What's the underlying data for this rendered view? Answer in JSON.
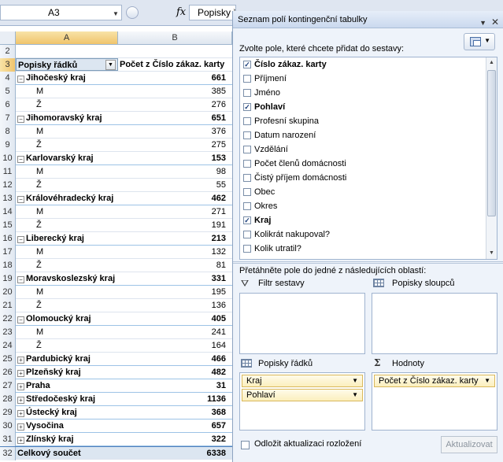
{
  "formula_bar": {
    "name_box": "A3",
    "fx": "fx",
    "formula": "Popisky řádků"
  },
  "grid": {
    "col_headers": [
      "A",
      "B"
    ],
    "header": {
      "row": "3",
      "label_a": "Popisky řádků",
      "label_b": "Počet z Číslo zákaz. karty"
    },
    "rows": [
      {
        "num": "4",
        "label": "Jihočeský kraj",
        "value": "661",
        "kind": "region",
        "exp": "⊟"
      },
      {
        "num": "5",
        "label": "M",
        "value": "385",
        "kind": "sub"
      },
      {
        "num": "6",
        "label": "Ž",
        "value": "276",
        "kind": "sub"
      },
      {
        "num": "7",
        "label": "Jihomoravský kraj",
        "value": "651",
        "kind": "region",
        "exp": "⊟"
      },
      {
        "num": "8",
        "label": "M",
        "value": "376",
        "kind": "sub"
      },
      {
        "num": "9",
        "label": "Ž",
        "value": "275",
        "kind": "sub"
      },
      {
        "num": "10",
        "label": "Karlovarský kraj",
        "value": "153",
        "kind": "region",
        "exp": "⊟"
      },
      {
        "num": "11",
        "label": "M",
        "value": "98",
        "kind": "sub"
      },
      {
        "num": "12",
        "label": "Ž",
        "value": "55",
        "kind": "sub"
      },
      {
        "num": "13",
        "label": "Královéhradecký kraj",
        "value": "462",
        "kind": "region",
        "exp": "⊟"
      },
      {
        "num": "14",
        "label": "M",
        "value": "271",
        "kind": "sub"
      },
      {
        "num": "15",
        "label": "Ž",
        "value": "191",
        "kind": "sub"
      },
      {
        "num": "16",
        "label": "Liberecký kraj",
        "value": "213",
        "kind": "region",
        "exp": "⊟"
      },
      {
        "num": "17",
        "label": "M",
        "value": "132",
        "kind": "sub"
      },
      {
        "num": "18",
        "label": "Ž",
        "value": "81",
        "kind": "sub"
      },
      {
        "num": "19",
        "label": "Moravskoslezský kraj",
        "value": "331",
        "kind": "region",
        "exp": "⊟"
      },
      {
        "num": "20",
        "label": "M",
        "value": "195",
        "kind": "sub"
      },
      {
        "num": "21",
        "label": "Ž",
        "value": "136",
        "kind": "sub"
      },
      {
        "num": "22",
        "label": "Olomoucký kraj",
        "value": "405",
        "kind": "region",
        "exp": "⊟"
      },
      {
        "num": "23",
        "label": "M",
        "value": "241",
        "kind": "sub"
      },
      {
        "num": "24",
        "label": "Ž",
        "value": "164",
        "kind": "sub"
      },
      {
        "num": "25",
        "label": "Pardubický kraj",
        "value": "466",
        "kind": "region",
        "exp": "⊞"
      },
      {
        "num": "26",
        "label": "Plzeňský kraj",
        "value": "482",
        "kind": "region",
        "exp": "⊞"
      },
      {
        "num": "27",
        "label": "Praha",
        "value": "31",
        "kind": "region",
        "exp": "⊞"
      },
      {
        "num": "28",
        "label": "Středočeský kraj",
        "value": "1136",
        "kind": "region",
        "exp": "⊞"
      },
      {
        "num": "29",
        "label": "Ústecký kraj",
        "value": "368",
        "kind": "region",
        "exp": "⊞"
      },
      {
        "num": "30",
        "label": "Vysočina",
        "value": "657",
        "kind": "region",
        "exp": "⊞"
      },
      {
        "num": "31",
        "label": "Zlínský kraj",
        "value": "322",
        "kind": "region",
        "exp": "⊞"
      },
      {
        "num": "32",
        "label": "Celkový součet",
        "value": "6338",
        "kind": "total"
      }
    ],
    "row2": "2"
  },
  "panel": {
    "title": "Seznam polí kontingenční tabulky",
    "fields_prompt": "Zvolte pole, které chcete přidat do sestavy:",
    "fields": [
      {
        "label": "Číslo zákaz. karty",
        "checked": true
      },
      {
        "label": "Příjmení",
        "checked": false
      },
      {
        "label": "Jméno",
        "checked": false
      },
      {
        "label": "Pohlaví",
        "checked": true
      },
      {
        "label": "Profesní skupina",
        "checked": false
      },
      {
        "label": "Datum narození",
        "checked": false
      },
      {
        "label": "Vzdělání",
        "checked": false
      },
      {
        "label": "Počet členů domácnosti",
        "checked": false
      },
      {
        "label": "Čistý příjem domácnosti",
        "checked": false
      },
      {
        "label": "Obec",
        "checked": false
      },
      {
        "label": "Okres",
        "checked": false
      },
      {
        "label": "Kraj",
        "checked": true
      },
      {
        "label": "Kolikrát nakupoval?",
        "checked": false
      },
      {
        "label": "Kolik utratil?",
        "checked": false
      }
    ],
    "drag_prompt": "Přetáhněte pole do jedné z následujících oblastí:",
    "zones": {
      "filter": {
        "label": "Filtr sestavy"
      },
      "columns": {
        "label": "Popisky sloupců"
      },
      "rows": {
        "label": "Popisky řádků",
        "items": [
          "Kraj",
          "Pohlaví"
        ]
      },
      "values": {
        "label": "Hodnoty",
        "items": [
          "Počet z Číslo zákaz. karty"
        ]
      }
    },
    "defer_label": "Odložit aktualizaci rozložení",
    "update_button": "Aktualizovat"
  }
}
